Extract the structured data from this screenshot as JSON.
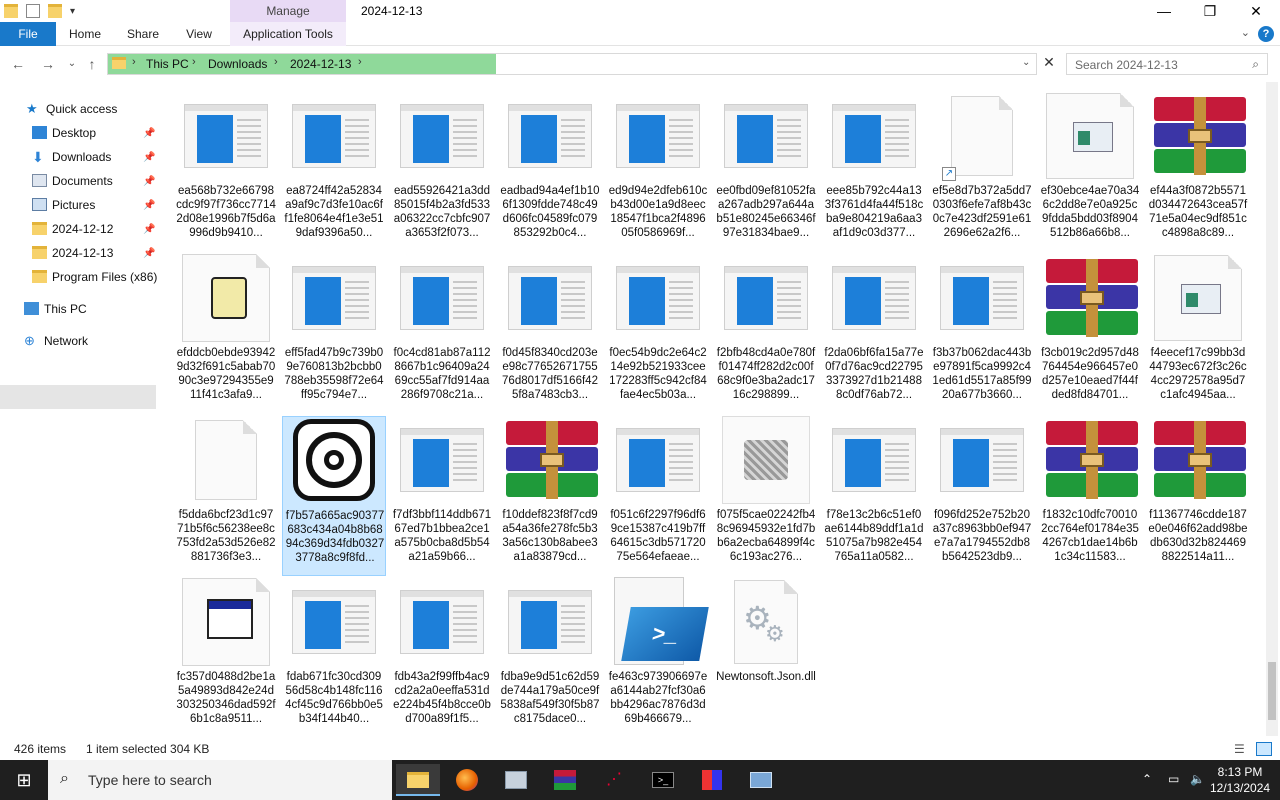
{
  "window": {
    "title": "2024-12-13",
    "context_tab": "Manage",
    "controls": {
      "minimize": "—",
      "maximize": "❐",
      "close": "✕"
    }
  },
  "ribbon": {
    "tabs": [
      "File",
      "Home",
      "Share",
      "View",
      "Application Tools"
    ],
    "expand": "⌄",
    "help": "?"
  },
  "nav": {
    "back": "←",
    "forward": "→",
    "recent": "⌄",
    "up": "↑",
    "breadcrumb": [
      "This PC",
      "Downloads",
      "2024-12-13"
    ],
    "search_placeholder": "Search 2024-12-13"
  },
  "sidebar": {
    "items": [
      {
        "label": "Quick access",
        "icon": "star-icon",
        "pinned": false
      },
      {
        "label": "Desktop",
        "icon": "desktop-icon",
        "pinned": true
      },
      {
        "label": "Downloads",
        "icon": "download-icon",
        "pinned": true
      },
      {
        "label": "Documents",
        "icon": "documents-icon",
        "pinned": true
      },
      {
        "label": "Pictures",
        "icon": "pictures-icon",
        "pinned": true
      },
      {
        "label": "2024-12-12",
        "icon": "folder-icon",
        "pinned": true
      },
      {
        "label": "2024-12-13",
        "icon": "folder-icon",
        "pinned": true
      },
      {
        "label": "Program Files (x86)",
        "icon": "folder-icon",
        "pinned": false
      },
      {
        "label": "This PC",
        "icon": "pc-icon",
        "pinned": false
      },
      {
        "label": "Network",
        "icon": "network-icon",
        "pinned": false
      }
    ]
  },
  "files": [
    {
      "name": "ea568b732e66798cdc9f97f736cc77142d08e1996b7f5d6a996d9b9410...",
      "type": "app"
    },
    {
      "name": "ea8724ff42a52834a9af9c7d3fe10ac6ff1fe8064e4f1e3e519daf9396a50...",
      "type": "app"
    },
    {
      "name": "ead55926421a3dd85015f4b2a3fd533a06322cc7cbfc907a3653f2f073...",
      "type": "app"
    },
    {
      "name": "eadbad94a4ef1b106f1309fdde748c49d606fc04589fc079853292b0c4...",
      "type": "app"
    },
    {
      "name": "ed9d94e2dfeb610cb43d00e1a9d8eec18547f1bca2f489605f0586969f...",
      "type": "app"
    },
    {
      "name": "ee0fbd09ef81052faa267adb297a644ab51e80245e66346f97e31834bae9...",
      "type": "app"
    },
    {
      "name": "eee85b792c44a133f3761d4fa44f518cba9e804219a6aa3af1d9c03d377...",
      "type": "app"
    },
    {
      "name": "ef5e8d7b372a5dd70303f6efe7af8b43c0c7e423df2591e612696e62a2f6...",
      "type": "shortcut"
    },
    {
      "name": "ef30ebce4ae70a346c2dd8e7e0a925c9fdda5bdd03f8904512b86a66b8...",
      "type": "window"
    },
    {
      "name": "ef44a3f0872b5571d034472643cea57f71e5a04ec9df851cc4898a8c89...",
      "type": "archive"
    },
    {
      "name": "efddcb0ebde939429d32f691c5abab7090c3e97294355e911f41c3afa9...",
      "type": "script"
    },
    {
      "name": "eff5fad47b9c739b09e760813b2bcbb0788eb35598f72e64ff95c794e7...",
      "type": "app"
    },
    {
      "name": "f0c4cd81ab87a1128667b1c96409a2469cc55af7fd914aa286f9708c21a...",
      "type": "app"
    },
    {
      "name": "f0d45f8340cd203ee98c7765267175576d8017df5166f425f8a7483cb3...",
      "type": "app"
    },
    {
      "name": "f0ec54b9dc2e64c214e92b521933cee172283ff5c942cf84fae4ec5b03a...",
      "type": "app"
    },
    {
      "name": "f2bfb48cd4a0e780ff01474ff282d2c00f68c9f0e3ba2adc1716c298899...",
      "type": "app"
    },
    {
      "name": "f2da06bf6fa15a77e0f7d76ac9cd227953373927d1b214888c0df76ab72...",
      "type": "app"
    },
    {
      "name": "f3b37b062dac443be97891f5ca9992c41ed61d5517a85f9920a677b3660...",
      "type": "app"
    },
    {
      "name": "f3cb019c2d957d48764454e966457e0d257e10eaed7f44fded8fd84701...",
      "type": "archive"
    },
    {
      "name": "f4eecef17c99bb3d44793ec672f3c26c4cc2972578a95d7c1afc4945aa...",
      "type": "window"
    },
    {
      "name": "f5dda6bcf23d1c9771b5f6c56238ee8c753fd2a53d526e82881736f3e3...",
      "type": "blank"
    },
    {
      "name": "f7b57a665ac90377683c434a04b8b6894c369d34fdb03273778a8c9f8fd...",
      "type": "logo",
      "selected": true
    },
    {
      "name": "f7df3bbf114ddb67167ed7b1bbea2ce1a575b0cba8d5b54a21a59b66...",
      "type": "app"
    },
    {
      "name": "f10ddef823f8f7cd9a54a36fe278fc5b33a56c130b8abee3a1a83879cd...",
      "type": "archive"
    },
    {
      "name": "f051c6f2297f96df69ce15387c419b7ff64615c3db57172075e564efaeae...",
      "type": "app"
    },
    {
      "name": "f075f5cae02242fb48c96945932e1fd7bb6a2ecba64899f4c6c193ac276...",
      "type": "scribble"
    },
    {
      "name": "f78e13c2b6c51ef0ae6144b89ddf1a1d51075a7b982e454765a11a0582...",
      "type": "app"
    },
    {
      "name": "f096fd252e752b20a37c8963bb0ef947e7a7a1794552db8b5642523db9...",
      "type": "app"
    },
    {
      "name": "f1832c10dfc700102cc764ef01784e354267cb1dae14b6b1c34c11583...",
      "type": "archive"
    },
    {
      "name": "f11367746cdde187e0e046f62add98bedb630d32b8244698822514a11...",
      "type": "archive"
    },
    {
      "name": "fc357d0488d2be1a5a49893d842e24d303250346dad592f6b1c8a9511...",
      "type": "window-small"
    },
    {
      "name": "fdab671fc30cd30956d58c4b148fc1164cf45c9d766bb0e5b34f144b40...",
      "type": "app"
    },
    {
      "name": "fdb43a2f99ffb4ac9cd2a2a0eeffa531de224b45f4b8cce0bd700a89f1f5...",
      "type": "app"
    },
    {
      "name": "fdba9e9d51c62d59de744a179a50ce9f5838af549f30f5b87c8175dace0...",
      "type": "app"
    },
    {
      "name": "fe463c973906697ea6144ab27fcf30a6bb4296ac7876d3d69b466679...",
      "type": "powershell"
    },
    {
      "name": "Newtonsoft.Json.dll",
      "type": "dll"
    }
  ],
  "status": {
    "count": "426 items",
    "selection": "1 item selected  304 KB"
  },
  "taskbar": {
    "search_placeholder": "Type here to search",
    "apps": [
      "file-explorer-icon",
      "firefox-icon",
      "network-tool-icon",
      "winrar-icon",
      "tool-icon",
      "terminal-icon",
      "app-icon",
      "rdp-icon"
    ],
    "time": "8:13 PM",
    "date": "12/13/2024"
  },
  "colors": {
    "file_tab": "#1979ca",
    "address_highlight": "#8fd99a",
    "selection": "#cce8ff",
    "taskbar": "#1f1f1f"
  }
}
